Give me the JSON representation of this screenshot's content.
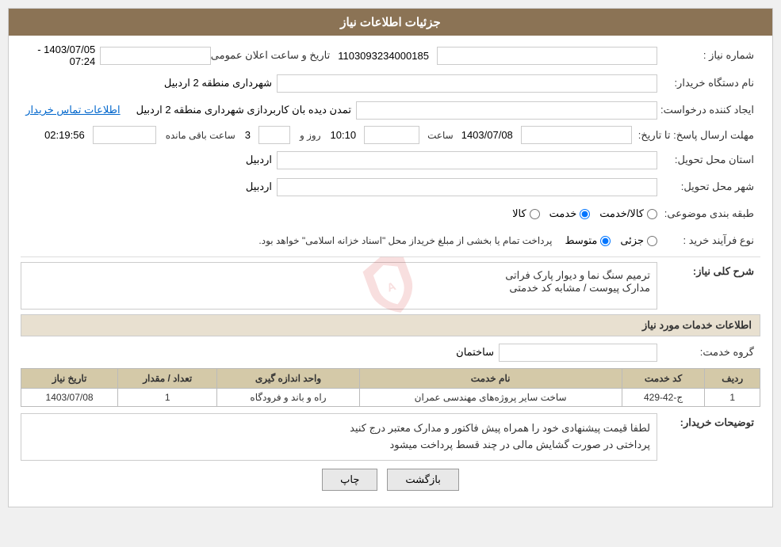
{
  "header": {
    "title": "جزئیات اطلاعات نیاز"
  },
  "fields": {
    "need_number_label": "شماره نیاز :",
    "need_number_value": "1103093234000185",
    "buyer_org_label": "نام دستگاه خریدار:",
    "buyer_org_value": "شهرداری منطقه 2 اردبیل",
    "creator_label": "ایجاد کننده درخواست:",
    "creator_value": "تمدن دیده بان کاربردازی شهرداری منطقه 2 اردبیل",
    "contact_link": "اطلاعات تماس خریدار",
    "deadline_label": "مهلت ارسال پاسخ: تا تاریخ:",
    "deadline_date": "1403/07/08",
    "deadline_time_label": "ساعت",
    "deadline_time": "10:10",
    "deadline_days_label": "روز و",
    "deadline_days": "3",
    "deadline_remaining_label": "ساعت باقی مانده",
    "deadline_remaining": "02:19:56",
    "province_label": "استان محل تحویل:",
    "province_value": "اردبیل",
    "city_label": "شهر محل تحویل:",
    "city_value": "اردبیل",
    "category_label": "طبقه بندی موضوعی:",
    "category_kala": "کالا",
    "category_khedmat": "خدمت",
    "category_kala_khedmat": "کالا/خدمت",
    "category_selected": "khedmat",
    "purchase_type_label": "نوع فرآیند خرید :",
    "purchase_type_jozee": "جزئی",
    "purchase_type_motavasset": "متوسط",
    "purchase_type_selected": "motavasset",
    "purchase_type_note": "پرداخت تمام یا بخشی از مبلغ خریداز محل \"اسناد خزانه اسلامی\" خواهد بود.",
    "announce_date_label": "تاریخ و ساعت اعلان عمومی:",
    "announce_date_value": "1403/07/05 - 07:24",
    "description_section_title": "شرح کلی نیاز:",
    "description_text_line1": "ترمیم سنگ نما و دیوار پارک فراتی",
    "description_text_line2": "مدارک پیوست / مشابه کد خدمتی",
    "services_section_title": "اطلاعات خدمات مورد نیاز",
    "service_group_label": "گروه خدمت:",
    "service_group_value": "ساختمان",
    "services_table": {
      "headers": [
        "ردیف",
        "کد خدمت",
        "نام خدمت",
        "واحد اندازه گیری",
        "تعداد / مقدار",
        "تاریخ نیاز"
      ],
      "rows": [
        {
          "row_num": "1",
          "service_code": "ج-42-429",
          "service_name": "ساخت سایر پروژه‌های مهندسی عمران",
          "unit": "راه و باند و فرودگاه",
          "quantity": "1",
          "need_date": "1403/07/08"
        }
      ]
    },
    "buyer_notes_label": "توضیحات خریدار:",
    "buyer_notes_text_line1": "لطفا قیمت پیشنهادی خود را همراه پیش فاکتور و مدارک معتبر درج کنید",
    "buyer_notes_text_line2": "پرداختی در صورت گشایش مالی در چند قسط پرداخت میشود",
    "btn_print": "چاپ",
    "btn_back": "بازگشت"
  }
}
